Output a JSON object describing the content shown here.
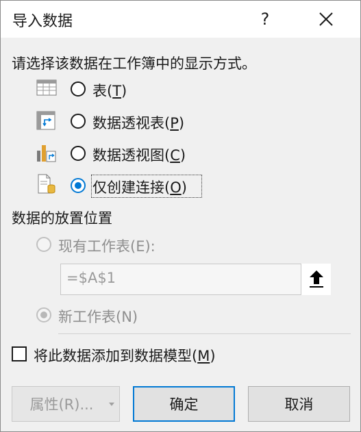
{
  "dialog": {
    "title": "导入数据",
    "help": "?",
    "close_icon": "close-icon"
  },
  "display_section": {
    "prompt": "请选择该数据在工作簿中的显示方式。",
    "options": [
      {
        "label": "表(",
        "key": "T",
        "suffix": ")",
        "icon": "table-icon",
        "selected": false
      },
      {
        "label": "数据透视表(",
        "key": "P",
        "suffix": ")",
        "icon": "pivot-table-icon",
        "selected": false
      },
      {
        "label": "数据透视图(",
        "key": "C",
        "suffix": ")",
        "icon": "pivot-chart-icon",
        "selected": false
      },
      {
        "label": "仅创建连接(",
        "key": "O",
        "suffix": ")",
        "icon": "connection-only-icon",
        "selected": true
      }
    ]
  },
  "placement_section": {
    "heading": "数据的放置位置",
    "existing_label": "现有工作表(E):",
    "existing_selected": false,
    "range_value": "=$A$1",
    "new_label": "新工作表(N)",
    "new_selected": true,
    "enabled": false
  },
  "data_model": {
    "label_before": "将此数据添加到数据模型(",
    "key": "M",
    "label_after": ")",
    "checked": false
  },
  "buttons": {
    "properties": "属性(R)...",
    "ok": "确定",
    "cancel": "取消"
  },
  "colors": {
    "accent": "#0078d4",
    "background": "#f0f0f0"
  }
}
